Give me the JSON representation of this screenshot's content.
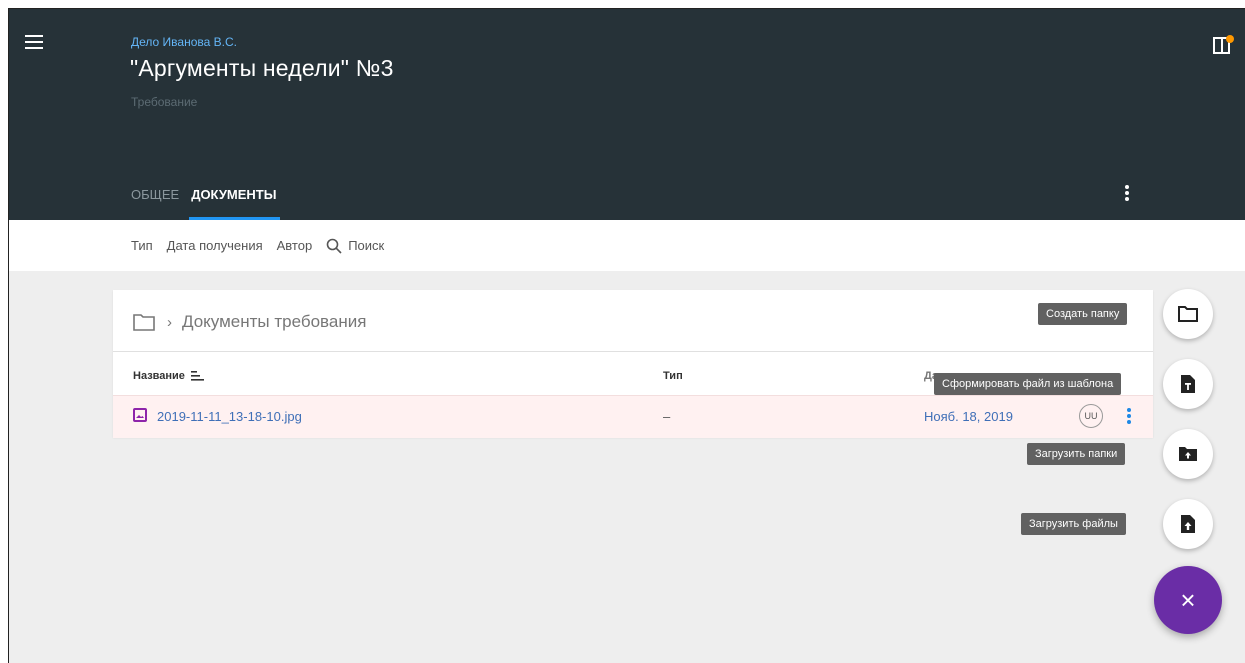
{
  "header": {
    "case_link": "Дело Иванова В.С.",
    "title": "\"Аргументы недели\" №3",
    "subtitle": "Требование",
    "tabs": [
      {
        "label": "ОБЩЕЕ",
        "active": false
      },
      {
        "label": "ДОКУМЕНТЫ",
        "active": true
      }
    ]
  },
  "filters": {
    "type": "Тип",
    "date": "Дата получения",
    "author": "Автор",
    "search": "Поиск"
  },
  "folder": {
    "breadcrumb": "Документы требования"
  },
  "table": {
    "columns": {
      "name": "Название",
      "type": "Тип",
      "date": "Дата получения"
    },
    "rows": [
      {
        "name": "2019-11-11_13-18-10.jpg",
        "type": "–",
        "date": "Нояб. 18, 2019",
        "author": "UU"
      }
    ]
  },
  "actions": {
    "create_folder": "Создать папку",
    "from_template": "Сформировать файл из шаблона",
    "upload_folders": "Загрузить папки",
    "upload_files": "Загрузить файлы",
    "close": "×"
  },
  "colors": {
    "header_bg": "#263238",
    "tab_indicator": "#2196f3",
    "fab_main": "#6a2da6",
    "link": "#3f6fb7",
    "row_highlight": "#fff1f1"
  }
}
